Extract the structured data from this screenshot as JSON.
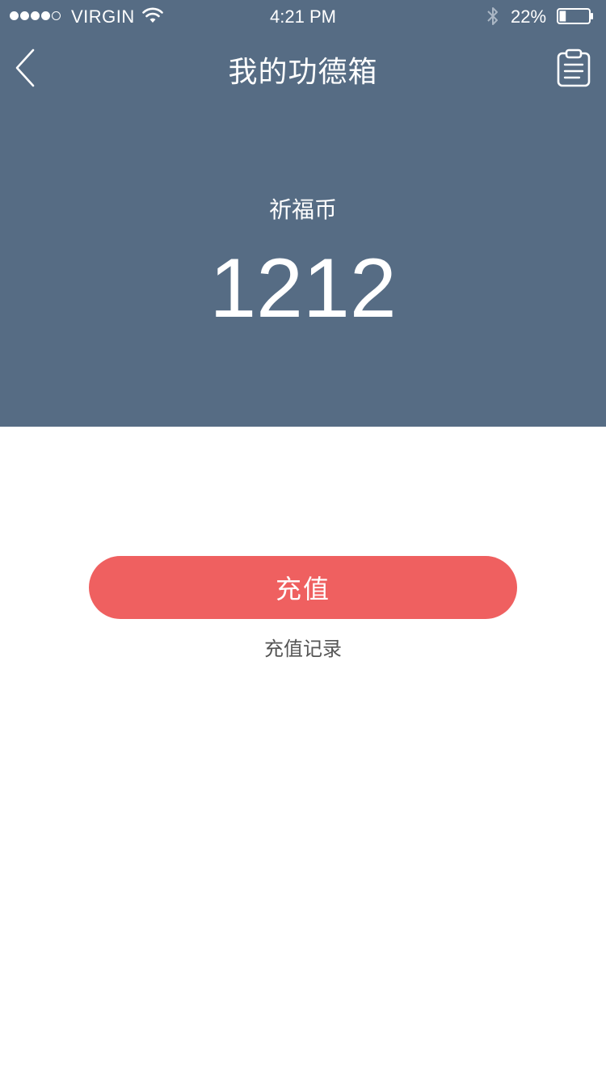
{
  "status_bar": {
    "signal_dots": [
      true,
      true,
      true,
      true,
      false
    ],
    "carrier": "VIRGIN",
    "time": "4:21 PM",
    "battery_percent": "22%",
    "battery_level": 0.22
  },
  "nav": {
    "back_icon": "chevron-left-icon",
    "title": "我的功德箱",
    "right_icon": "clipboard-icon"
  },
  "balance": {
    "label": "祈福币",
    "value": "1212"
  },
  "actions": {
    "recharge_label": "充值",
    "history_label": "充值记录"
  },
  "colors": {
    "header_bg": "#566c84",
    "button_bg": "#ef6060",
    "text_white": "#ffffff",
    "link_text": "#555555"
  }
}
